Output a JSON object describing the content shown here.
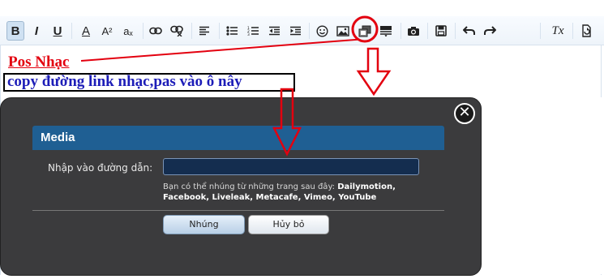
{
  "toolbar": {
    "bold": "B",
    "italic": "I",
    "underline": "U",
    "text_color": "A",
    "font_size": "A²",
    "subscript": "aₓ",
    "clear_format": "Tx"
  },
  "content": {
    "line1": "Pos Nhạc",
    "line2": "copy đường link nhạc,pas vào ô nây"
  },
  "modal": {
    "title": "Media",
    "close": "✕",
    "field_label": "Nhập vào đường dẫn:",
    "field_value": "",
    "hint_prefix": "Bạn có thể nhúng từ những trang sau đây: ",
    "hint_sites": "Dailymotion, Facebook, Liveleak, Metacafe, Vimeo, YouTube",
    "embed_button": "Nhúng",
    "cancel_button": "Hủy bỏ"
  },
  "colors": {
    "annotation_red": "#e3000f",
    "line2_blue": "#1d1db8",
    "modal_header": "#1f5f93"
  }
}
